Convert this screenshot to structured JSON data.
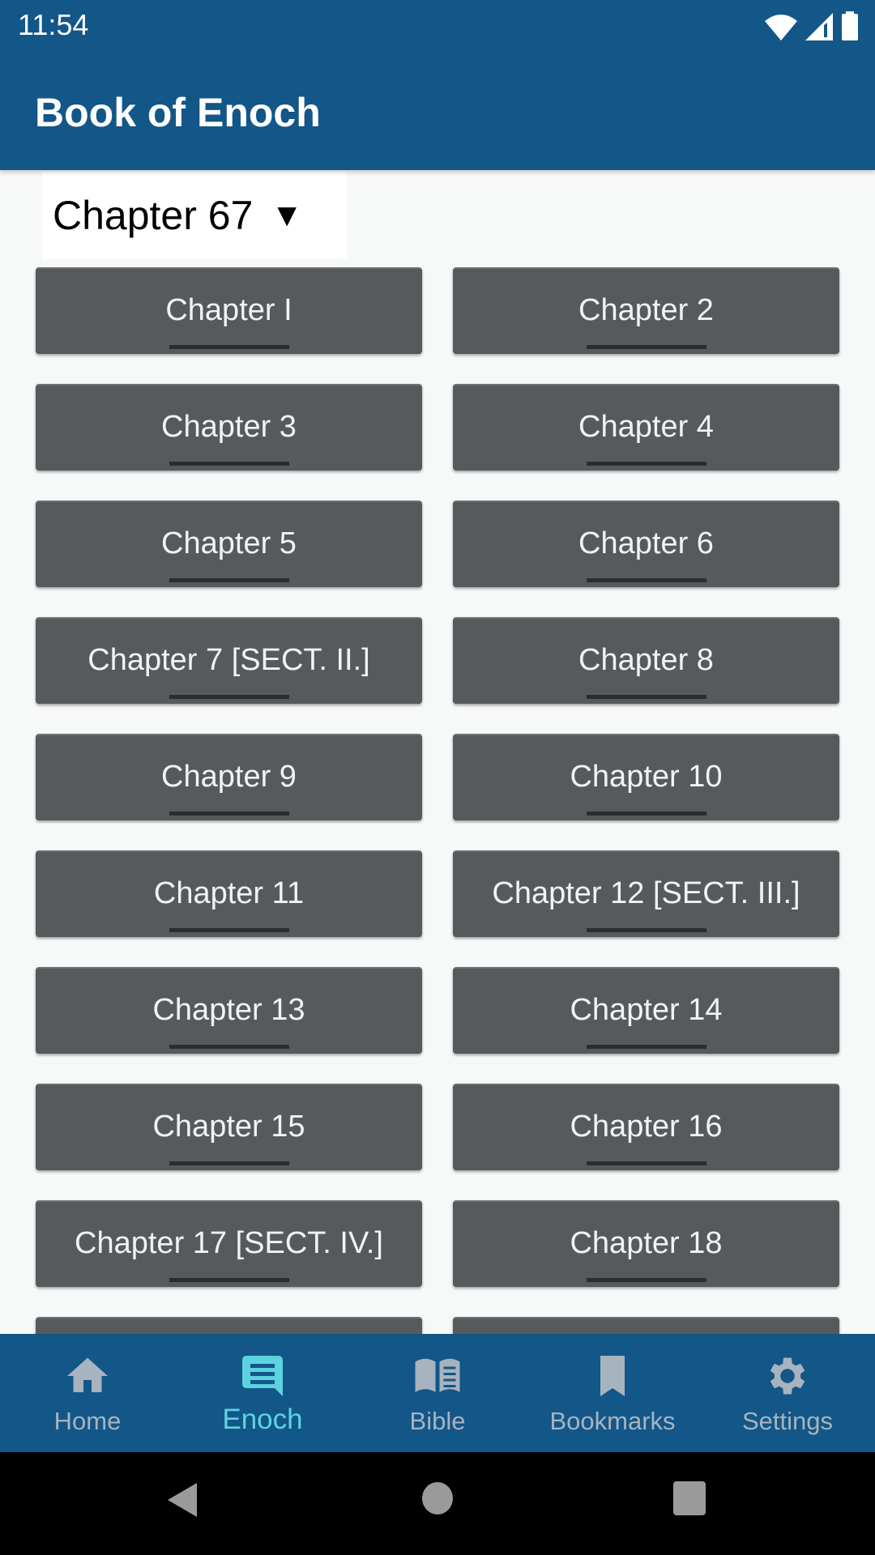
{
  "status_bar": {
    "time": "11:54",
    "icons": [
      "wifi-icon",
      "signal-icon",
      "battery-icon"
    ]
  },
  "app_bar": {
    "title": "Book of Enoch"
  },
  "chapter_select": {
    "selected": "Chapter 67",
    "arrow": "▼"
  },
  "chapters": [
    "Chapter I",
    "Chapter 2",
    "Chapter 3",
    "Chapter 4",
    "Chapter 5",
    "Chapter 6",
    "Chapter 7 [SECT. II.]",
    "Chapter 8",
    "Chapter 9",
    "Chapter 10",
    "Chapter 11",
    "Chapter 12 [SECT. III.]",
    "Chapter 13",
    "Chapter 14",
    "Chapter 15",
    "Chapter 16",
    "Chapter 17 [SECT. IV.]",
    "Chapter 18",
    "",
    ""
  ],
  "bottom_nav": {
    "active": "Enoch",
    "items": [
      {
        "label": "Home",
        "icon": "home-icon"
      },
      {
        "label": "Enoch",
        "icon": "chat-message-icon"
      },
      {
        "label": "Bible",
        "icon": "open-book-icon"
      },
      {
        "label": "Bookmarks",
        "icon": "bookmark-icon"
      },
      {
        "label": "Settings",
        "icon": "gear-icon"
      }
    ]
  },
  "colors": {
    "primary": "#135688",
    "active_tab": "#5dd3e0",
    "inactive_tab": "#a7b3bf",
    "button": "#575a5d"
  }
}
